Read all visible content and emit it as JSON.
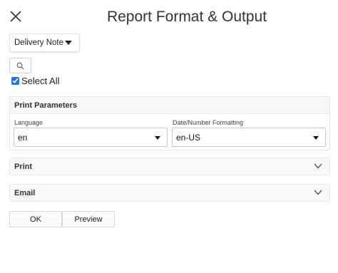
{
  "dialog": {
    "title": "Report Format & Output",
    "close_icon": "close-icon"
  },
  "format_dropdown": {
    "selected": "Delivery Note",
    "icon": "caret-down-icon"
  },
  "search_button": {
    "icon": "search-icon"
  },
  "select_all": {
    "label": "Select All",
    "checked": true
  },
  "print_parameters": {
    "heading": "Print Parameters",
    "language": {
      "label": "Language",
      "value": "en"
    },
    "formatting": {
      "label": "Date/Number Formatting",
      "value": "en-US"
    }
  },
  "sections": {
    "print": {
      "heading": "Print",
      "icon": "chevron-down-icon"
    },
    "email": {
      "heading": "Email",
      "icon": "chevron-down-icon"
    }
  },
  "actions": {
    "ok_label": "OK",
    "preview_label": "Preview"
  },
  "colors": {
    "checkbox_accent": "#1a73e8",
    "panel_header_bg": "#f7f7f7"
  }
}
